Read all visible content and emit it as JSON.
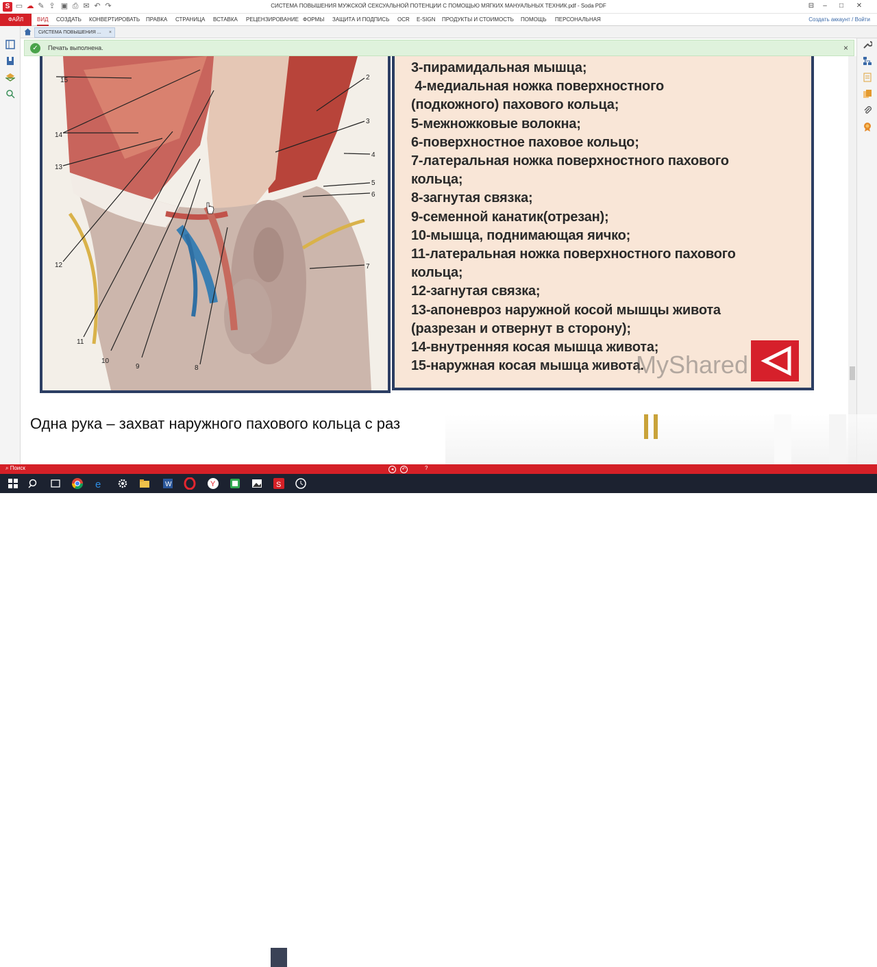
{
  "app": {
    "logo": "S",
    "title": "СИСТЕМА ПОВЫШЕНИЯ МУЖСКОЙ СЕКСУАЛЬНОЙ ПОТЕНЦИИ С ПОМОЩЬЮ МЯГКИХ МАНУАЛЬНЫХ ТЕХНИК.pdf  -  Soda PDF",
    "account": "Создать аккаунт / Войти",
    "brand_color": "#d42027"
  },
  "menu": {
    "file": "ФАЙЛ",
    "items": [
      "ВИД",
      "СОЗДАТЬ",
      "КОНВЕРТИРОВАТЬ",
      "ПРАВКА",
      "СТРАНИЦА",
      "ВСТАВКА",
      "РЕЦЕНЗИРОВАНИЕ",
      "ФОРМЫ",
      "ЗАЩИТА И ПОДПИСЬ",
      "OCR",
      "E-SIGN",
      "ПРОДУКТЫ И СТОИМОСТЬ",
      "ПОМОЩЬ",
      "ПЕРСОНАЛЬНАЯ"
    ],
    "active": "ВИД"
  },
  "tabs": {
    "doc_tab": "СИСТЕМА ПОВЫШЕНИЯ ...",
    "close": "×"
  },
  "notification": {
    "text": "Печать выполнена.",
    "close": "×"
  },
  "slide": {
    "legend": [
      "3-пирамидальная мышца;",
      " 4-медиальная ножка поверхностного",
      "(подкожного) пахового кольца;",
      "5-межножковые волокна;",
      "6-поверхностное паховое кольцо;",
      "7-латеральная ножка поверхностного пахового",
      "кольца;",
      "8-загнутая связка;",
      "9-семенной канатик(отрезан);",
      "10-мышца, поднимающая яичко;",
      "11-латеральная ножка поверхностного пахового",
      "кольца;",
      "12-загнутая связка;",
      "13-апоневроз наружной косой мышцы живота",
      "(разрезан и отвернут в сторону);",
      "14-внутренняя косая мышца живота;",
      "15-наружная косая мышца живота."
    ],
    "figure_labels": [
      "15",
      "14",
      "13",
      "12",
      "11",
      "10",
      "9",
      "8",
      "7",
      "6",
      "5",
      "4",
      "3",
      "2"
    ],
    "watermark": "MyShared",
    "caption": "Одна рука – захват наружного пахового кольца с раз"
  },
  "statusbar": {
    "search": "Поиск",
    "page_marker": "?"
  }
}
